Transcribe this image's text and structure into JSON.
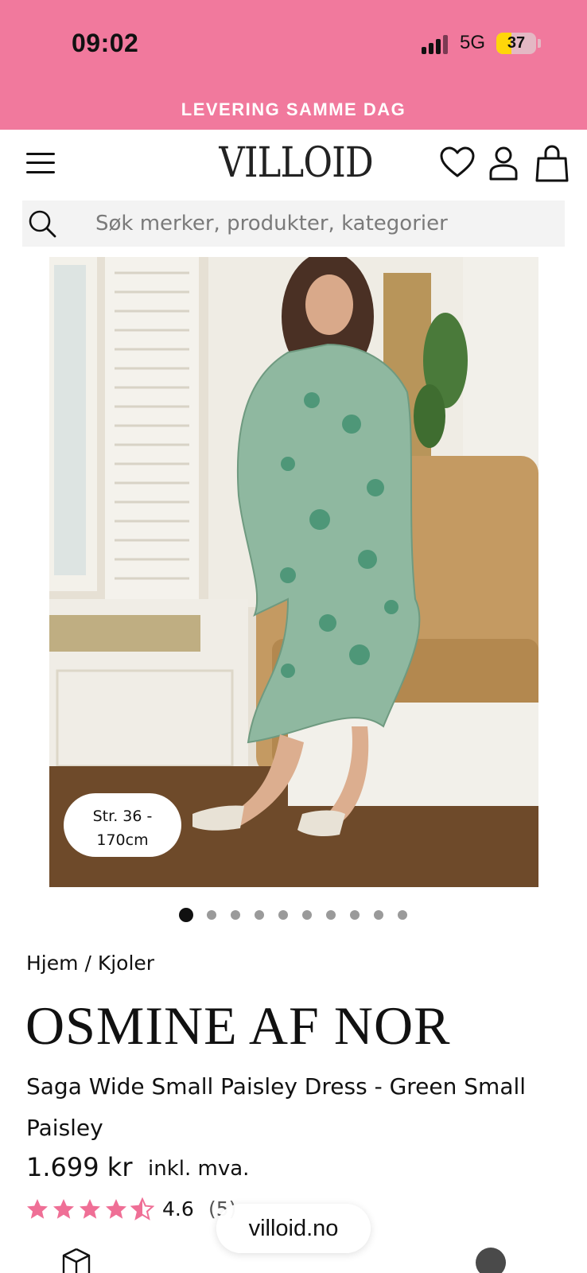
{
  "status_bar": {
    "time": "09:02",
    "network": "5G",
    "battery": "37",
    "battery_level": 0.37
  },
  "banner": {
    "text": "LEVERING SAMME DAG",
    "background": "#f1799d"
  },
  "header": {
    "logo": "VILLOID",
    "icons": [
      "menu-icon",
      "heart-icon",
      "user-icon",
      "bag-icon"
    ]
  },
  "search": {
    "placeholder": "Søk merker, produkter, kategorier",
    "value": "",
    "icon": "search-icon"
  },
  "gallery": {
    "size_badge": [
      "Str. 36 -",
      "170cm"
    ],
    "dots": 10,
    "active_dot": 0
  },
  "breadcrumb": {
    "home": "Hjem",
    "separator": "/",
    "category": "Kjoler"
  },
  "product": {
    "brand": "OSMINE AF NOR",
    "name": "Saga Wide Small Paisley Dress - Green Small Paisley",
    "price": "1.699 kr",
    "vat_note": "inkl. mva.",
    "rating": "4.6",
    "rating_value": 4.6,
    "review_count": "(5)",
    "star_color": "#ef6f96"
  },
  "browser": {
    "url": "villoid.no"
  },
  "bottom_icons": [
    "box-icon",
    "chat-icon"
  ]
}
